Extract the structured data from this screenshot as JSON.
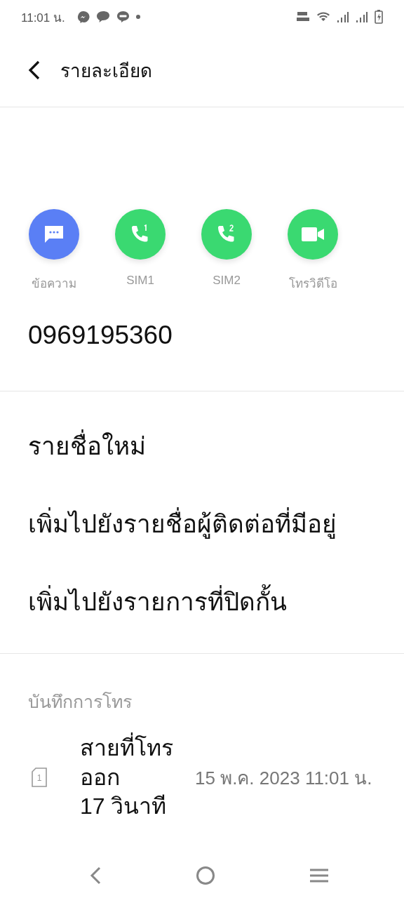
{
  "status_bar": {
    "time": "11:01 น."
  },
  "header": {
    "title": "รายละเอียด"
  },
  "actions": [
    {
      "kind": "message",
      "label": "ข้อความ",
      "color": "#5a7ff5"
    },
    {
      "kind": "sim1",
      "label": "SIM1",
      "color": "#3ad971"
    },
    {
      "kind": "sim2",
      "label": "SIM2",
      "color": "#3ad971"
    },
    {
      "kind": "video",
      "label": "โทรวิดีโอ",
      "color": "#3ad971"
    }
  ],
  "number": "0969195360",
  "options": [
    "รายชื่อใหม่",
    "เพิ่มไปยังรายชื่อผู้ติดต่อที่มีอยู่",
    "เพิ่มไปยังรายการที่ปิดกั้น"
  ],
  "call_log": {
    "title": "บันทึกการโทร",
    "entries": [
      {
        "sim": "1",
        "type": "สายที่โทรออก",
        "duration": "17 วินาที",
        "time": "15 พ.ค. 2023 11:01 น."
      }
    ]
  }
}
